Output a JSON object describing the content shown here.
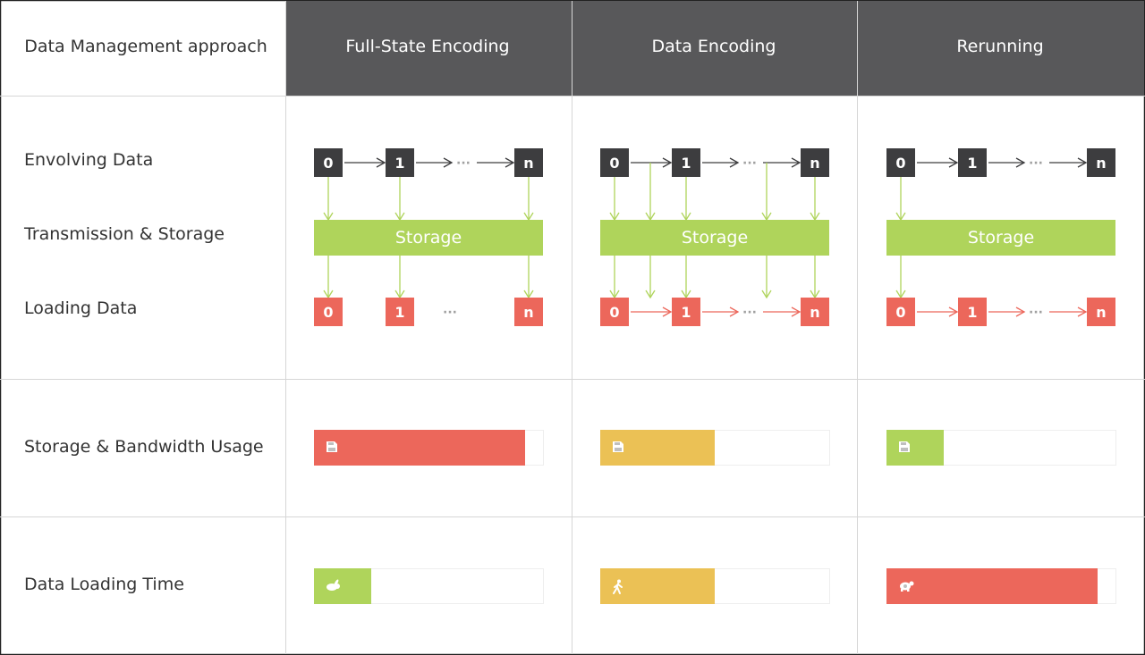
{
  "header": {
    "row_label": "Data Management approach",
    "columns": [
      "Full-State Encoding",
      "Data Encoding",
      "Rerunning"
    ]
  },
  "row_labels": {
    "evolving": "Envolving Data",
    "transmission": "Transmission & Storage",
    "loading": "Loading Data",
    "storage_usage": "Storage & Bandwidth Usage",
    "loading_time": "Data Loading Time"
  },
  "states": {
    "first": "0",
    "second": "1",
    "ellipsis": "···",
    "last": "n"
  },
  "storage_label": "Storage",
  "colors": {
    "header_bg": "#58585a",
    "state_box": "#3d3d3f",
    "loaded_box": "#ec675b",
    "storage_bar": "#afd45b",
    "high": "#ec675b",
    "medium": "#ebc155",
    "low": "#afd45b",
    "grid": "#d6d6d6"
  },
  "approaches": [
    {
      "name": "Full-State Encoding",
      "evolving_chain": true,
      "stored_states": [
        "0",
        "1",
        "n"
      ],
      "loaded_states": [
        "0",
        "1",
        "n"
      ],
      "loaded_chain": false,
      "storage_usage": {
        "level": "high",
        "fraction": 0.92,
        "icon": "floppy-disk-icon"
      },
      "loading_time": {
        "level": "low",
        "fraction": 0.25,
        "icon": "rabbit-icon"
      }
    },
    {
      "name": "Data Encoding",
      "evolving_chain": true,
      "stored_states": [
        "0",
        "0-1",
        "1",
        "1-n",
        "n"
      ],
      "loaded_states": [
        "0",
        "1",
        "n"
      ],
      "loaded_chain": true,
      "storage_usage": {
        "level": "medium",
        "fraction": 0.5,
        "icon": "floppy-disk-icon"
      },
      "loading_time": {
        "level": "medium",
        "fraction": 0.5,
        "icon": "walking-person-icon"
      }
    },
    {
      "name": "Rerunning",
      "evolving_chain": true,
      "stored_states": [
        "0"
      ],
      "loaded_states": [
        "0",
        "1",
        "n"
      ],
      "loaded_chain": true,
      "storage_usage": {
        "level": "low",
        "fraction": 0.25,
        "icon": "floppy-disk-icon"
      },
      "loading_time": {
        "level": "high",
        "fraction": 0.92,
        "icon": "turtle-icon"
      }
    }
  ]
}
